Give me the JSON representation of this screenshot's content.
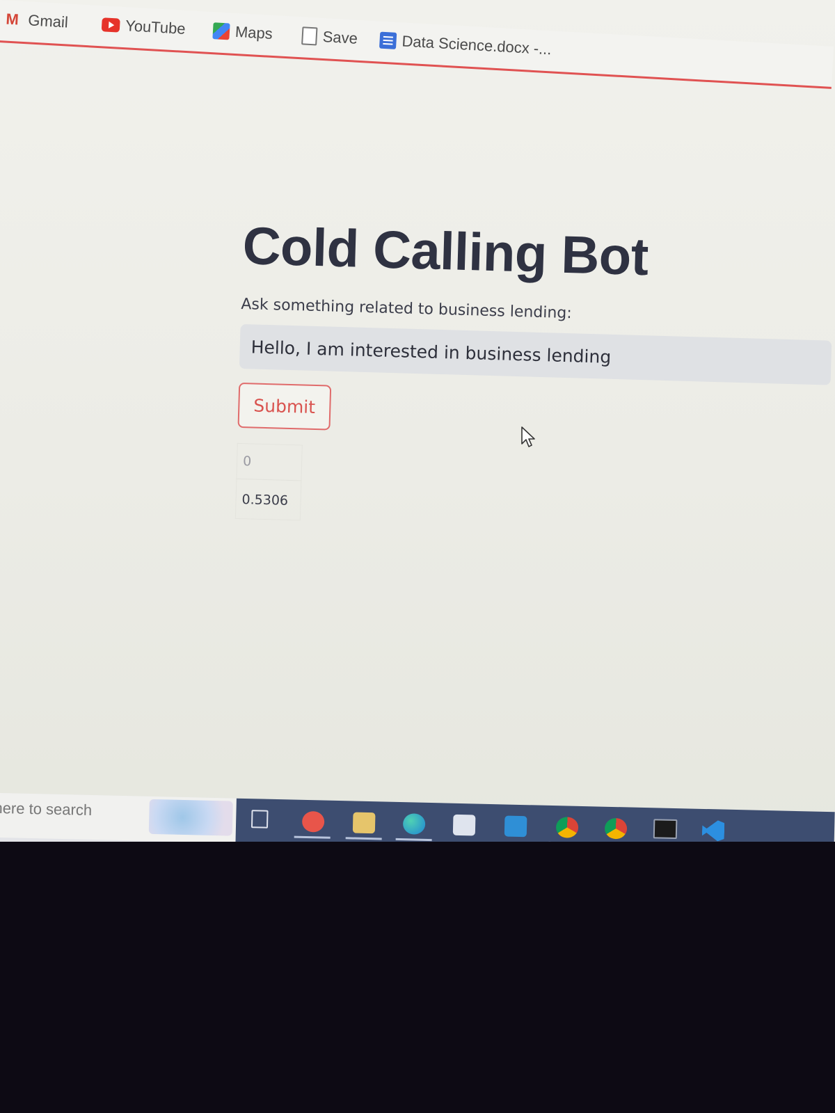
{
  "bookmarks": [
    {
      "label": "Gmail",
      "icon": "gmail-icon"
    },
    {
      "label": "YouTube",
      "icon": "youtube-icon"
    },
    {
      "label": "Maps",
      "icon": "maps-icon"
    },
    {
      "label": "Save",
      "icon": "document-icon"
    },
    {
      "label": "Data Science.docx -...",
      "icon": "docs-icon"
    }
  ],
  "app": {
    "title": "Cold Calling Bot",
    "prompt_label": "Ask something related to business lending:",
    "query_value": "Hello, I am interested in business lending",
    "submit_label": "Submit",
    "result_table": {
      "header": "0",
      "value": "0.5306"
    }
  },
  "taskbar": {
    "search_text": "here to search",
    "apps": [
      "task-view-icon",
      "wps-office-icon",
      "file-explorer-icon",
      "edge-icon",
      "store-icon",
      "mail-icon",
      "chrome-profile-icon",
      "chrome-icon",
      "terminal-icon",
      "vscode-icon"
    ]
  },
  "colors": {
    "accent": "#e05252",
    "submit_text": "#d9534f",
    "title": "#2f3242",
    "taskbar": "#3d4d70"
  }
}
